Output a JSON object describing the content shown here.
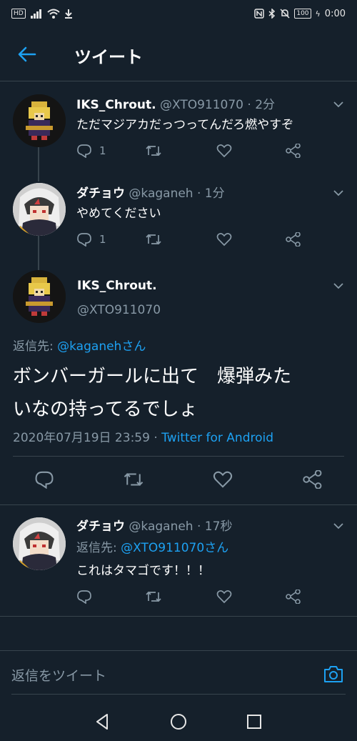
{
  "status": {
    "hd": "HD",
    "battery": "100",
    "time": "0:00"
  },
  "header": {
    "title": "ツイート"
  },
  "tweets": [
    {
      "name": "IKS_Chrout.",
      "handle": "@XTO911070",
      "time": "· 2分",
      "text": "ただマジアカだっつってんだろ燃やすぞ",
      "reply_count": "1"
    },
    {
      "name": "ダチョウ",
      "handle": "@kaganeh",
      "time": "· 1分",
      "text": "やめてください",
      "reply_count": "1"
    }
  ],
  "main_tweet": {
    "name": "IKS_Chrout.",
    "handle": "@XTO911070",
    "reply_prefix": "返信先: ",
    "reply_to": "@kaganehさん",
    "text_line1": "ボンバーガールに出て　爆弾みた",
    "text_line2": "いなの持ってるでしょ",
    "datetime": "2020年07月19日 23:59 · ",
    "source": "Twitter for Android"
  },
  "reply_tweet": {
    "name": "ダチョウ",
    "handle": "@kaganeh",
    "time": "· 17秒",
    "reply_prefix": "返信先: ",
    "reply_to": "@XTO911070さん",
    "text": "これはタマゴです！！！"
  },
  "reply_bar": {
    "placeholder": "返信をツイート"
  },
  "colors": {
    "background": "#15202b",
    "accent": "#1da1f2",
    "muted": "#8899a6",
    "divider": "#38444d"
  }
}
